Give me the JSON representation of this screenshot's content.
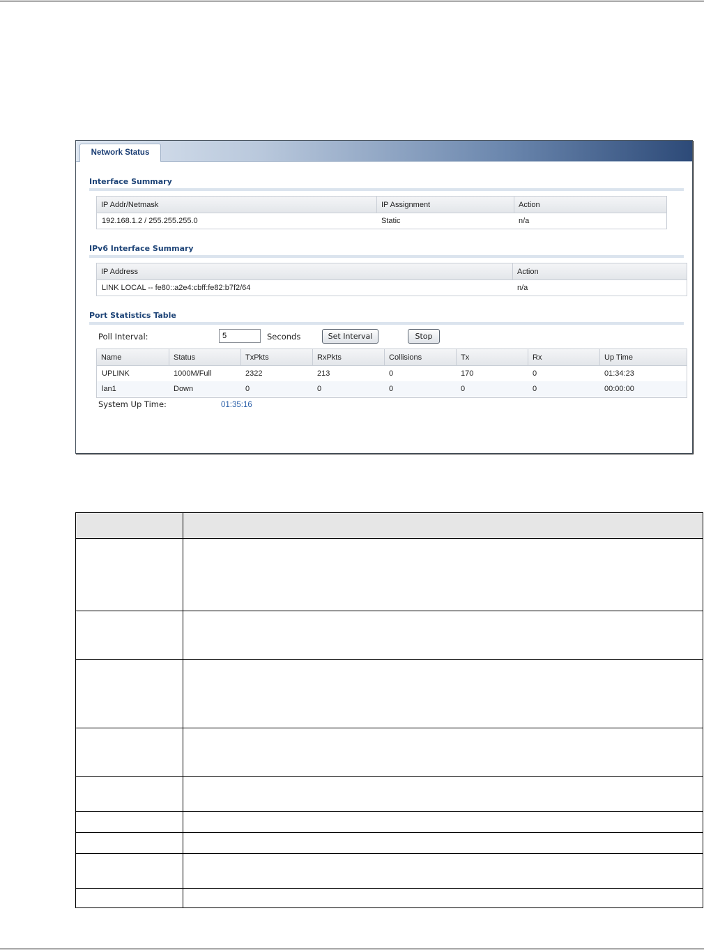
{
  "window": {
    "tab_label": "Network Status"
  },
  "interface_summary": {
    "title": "Interface Summary",
    "columns": [
      "IP Addr/Netmask",
      "IP Assignment",
      "Action"
    ],
    "rows": [
      [
        "192.168.1.2 / 255.255.255.0",
        "Static",
        "n/a"
      ]
    ]
  },
  "ipv6_summary": {
    "title": "IPv6 Interface Summary",
    "columns": [
      "IP Address",
      "Action"
    ],
    "rows": [
      [
        "LINK LOCAL -- fe80::a2e4:cbff:fe82:b7f2/64",
        "n/a"
      ]
    ]
  },
  "port_stats": {
    "title": "Port Statistics Table",
    "poll_label": "Poll Interval:",
    "poll_value": "5",
    "seconds_label": "Seconds",
    "set_interval_label": "Set Interval",
    "stop_label": "Stop",
    "columns": [
      "Name",
      "Status",
      "TxPkts",
      "RxPkts",
      "Collisions",
      "Tx",
      "Rx",
      "Up Time"
    ],
    "rows": [
      [
        "UPLINK",
        "1000M/Full",
        "2322",
        "213",
        "0",
        "170",
        "0",
        "01:34:23"
      ],
      [
        "lan1",
        "Down",
        "0",
        "0",
        "0",
        "0",
        "0",
        "00:00:00"
      ]
    ],
    "uptime_label": "System Up Time:",
    "uptime_value": "01:35:16"
  }
}
